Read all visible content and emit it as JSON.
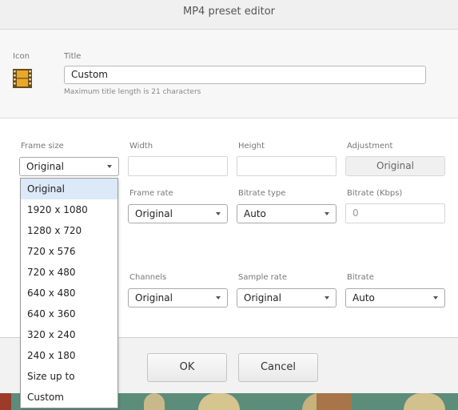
{
  "window": {
    "title": "MP4 preset editor"
  },
  "preset": {
    "icon_label": "Icon",
    "title_label": "Title",
    "title_value": "Custom",
    "title_hint": "Maximum title length is 21 characters"
  },
  "video": {
    "frame_size_label": "Frame size",
    "frame_size_value": "Original",
    "width_label": "Width",
    "height_label": "Height",
    "adjustment_label": "Adjustment",
    "adjustment_value": "Original",
    "frame_rate_label": "Frame rate",
    "frame_rate_value": "Original",
    "bitrate_type_label": "Bitrate type",
    "bitrate_type_value": "Auto",
    "bitrate_kbps_label": "Bitrate (Kbps)",
    "bitrate_kbps_placeholder": "0"
  },
  "audio": {
    "channels_label": "Channels",
    "channels_value": "Original",
    "sample_rate_label": "Sample rate",
    "sample_rate_value": "Original",
    "bitrate_label": "Bitrate",
    "bitrate_value": "Auto"
  },
  "frame_size_options": [
    "Original",
    "1920 x 1080",
    "1280 x 720",
    "720 x 576",
    "720 x 480",
    "640 x 480",
    "640 x 360",
    "320 x 240",
    "240 x 180",
    "Size up to",
    "Custom"
  ],
  "frame_size_selected_index": 0,
  "buttons": {
    "ok": "OK",
    "cancel": "Cancel"
  },
  "colors": {
    "dropdown_highlight": "#dbe9f8",
    "background_strip": "#5b8d7a",
    "film_icon": "#e8a92a"
  },
  "icons": {
    "preset_icon": "film-strip-icon"
  }
}
